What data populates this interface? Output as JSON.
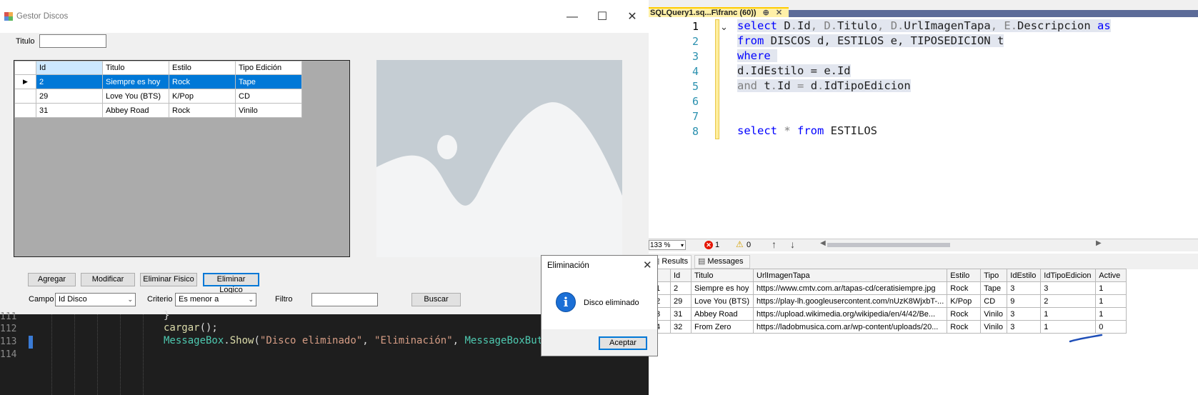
{
  "ssms": {
    "tab_title": "SQLQuery1.sq...F\\franc (60))",
    "tab_pin": "⊕",
    "tab_close": "✕",
    "line_numbers": [
      "1",
      "2",
      "3",
      "4",
      "5",
      "6",
      "7",
      "8"
    ],
    "code": {
      "l1a": "select",
      "l1b": " D",
      "l1c": ".",
      "l1d": "Id",
      "l1e": ", D",
      "l1f": ".",
      "l1g": "Titulo",
      "l1h": ", D",
      "l1i": ".",
      "l1j": "UrlImagenTapa",
      "l1k": ", E",
      "l1l": ".",
      "l1m": "Descripcion ",
      "l1n": "as",
      "l2a": "from",
      "l2b": " DISCOS d, ESTILOS e, TIPOSEDICION t",
      "l3a": "where",
      "l4a": "d.IdEstilo = e.Id",
      "l5a": "and",
      "l5b": " t",
      "l5c": ".",
      "l5d": "Id ",
      "l5e": "=",
      "l5f": " d",
      "l5g": ".",
      "l5h": "IdTipoEdicion",
      "l8a": "select",
      "l8b": " * ",
      "l8c": "from",
      "l8d": " ESTILOS"
    },
    "status": {
      "zoom": "133 %",
      "errors": "1",
      "warnings": "0"
    },
    "results_tab": "Results",
    "messages_tab": "Messages",
    "results": {
      "columns": [
        "Id",
        "Titulo",
        "UrlImagenTapa",
        "Estilo",
        "Tipo",
        "IdEstilo",
        "IdTipoEdicion",
        "Active"
      ],
      "rows": [
        {
          "num": "1",
          "Id": "2",
          "Titulo": "Siempre es hoy",
          "Url": "https://www.cmtv.com.ar/tapas-cd/ceratisiempre.jpg",
          "Estilo": "Rock",
          "Tipo": "Tape",
          "IdEstilo": "3",
          "IdTipoEdicion": "3",
          "Active": "1"
        },
        {
          "num": "2",
          "Id": "29",
          "Titulo": "Love You (BTS)",
          "Url": "https://play-lh.googleusercontent.com/nUzK8WjxbT-...",
          "Estilo": "K/Pop",
          "Tipo": "CD",
          "IdEstilo": "9",
          "IdTipoEdicion": "2",
          "Active": "1"
        },
        {
          "num": "3",
          "Id": "31",
          "Titulo": "Abbey Road",
          "Url": "https://upload.wikimedia.org/wikipedia/en/4/42/Be...",
          "Estilo": "Rock",
          "Tipo": "Vinilo",
          "IdEstilo": "3",
          "IdTipoEdicion": "1",
          "Active": "1"
        },
        {
          "num": "4",
          "Id": "32",
          "Titulo": "From Zero",
          "Url": "https://ladobmusica.com.ar/wp-content/uploads/20...",
          "Estilo": "Rock",
          "Tipo": "Vinilo",
          "IdEstilo": "3",
          "IdTipoEdicion": "1",
          "Active": "0"
        }
      ]
    }
  },
  "app": {
    "title": "Gestor Discos",
    "minimize": "—",
    "maximize": "☐",
    "close": "✕",
    "titulo_label": "Titulo",
    "titulo_value": "",
    "grid": {
      "columns": [
        "Id",
        "Titulo",
        "Estilo",
        "Tipo Edición"
      ],
      "rows": [
        {
          "id": "2",
          "titulo": "Siempre es hoy",
          "estilo": "Rock",
          "tipo": "Tape"
        },
        {
          "id": "29",
          "titulo": "Love You (BTS)",
          "estilo": "K/Pop",
          "tipo": "CD"
        },
        {
          "id": "31",
          "titulo": "Abbey Road",
          "estilo": "Rock",
          "tipo": "Vinilo"
        }
      ],
      "selected_row_marker": "▶"
    },
    "buttons": {
      "agregar": "Agregar",
      "modificar": "Modificar",
      "eliminar_fisico": "Eliminar Fisico",
      "eliminar_logico": "Eliminar Logico",
      "buscar": "Buscar"
    },
    "filter": {
      "campo_label": "Campo",
      "campo_value": "Id Disco",
      "criterio_label": "Criterio",
      "criterio_value": "Es menor a",
      "filtro_label": "Filtro",
      "filtro_value": ""
    }
  },
  "editor": {
    "lines": [
      "111",
      "112",
      "113",
      "114"
    ],
    "l111": "}",
    "l112a": "cargar",
    "l112b": "();",
    "l113a": "MessageBox",
    "l113b": ".",
    "l113c": "Show",
    "l113d": "(",
    "l113e": "\"Disco eliminado\"",
    "l113f": ", ",
    "l113g": "\"Eliminación\"",
    "l113h": ", ",
    "l113i": "MessageBoxButtor"
  },
  "msgbox": {
    "title": "Eliminación",
    "close": "✕",
    "icon": "i",
    "text": "Disco eliminado",
    "ok": "Aceptar"
  }
}
